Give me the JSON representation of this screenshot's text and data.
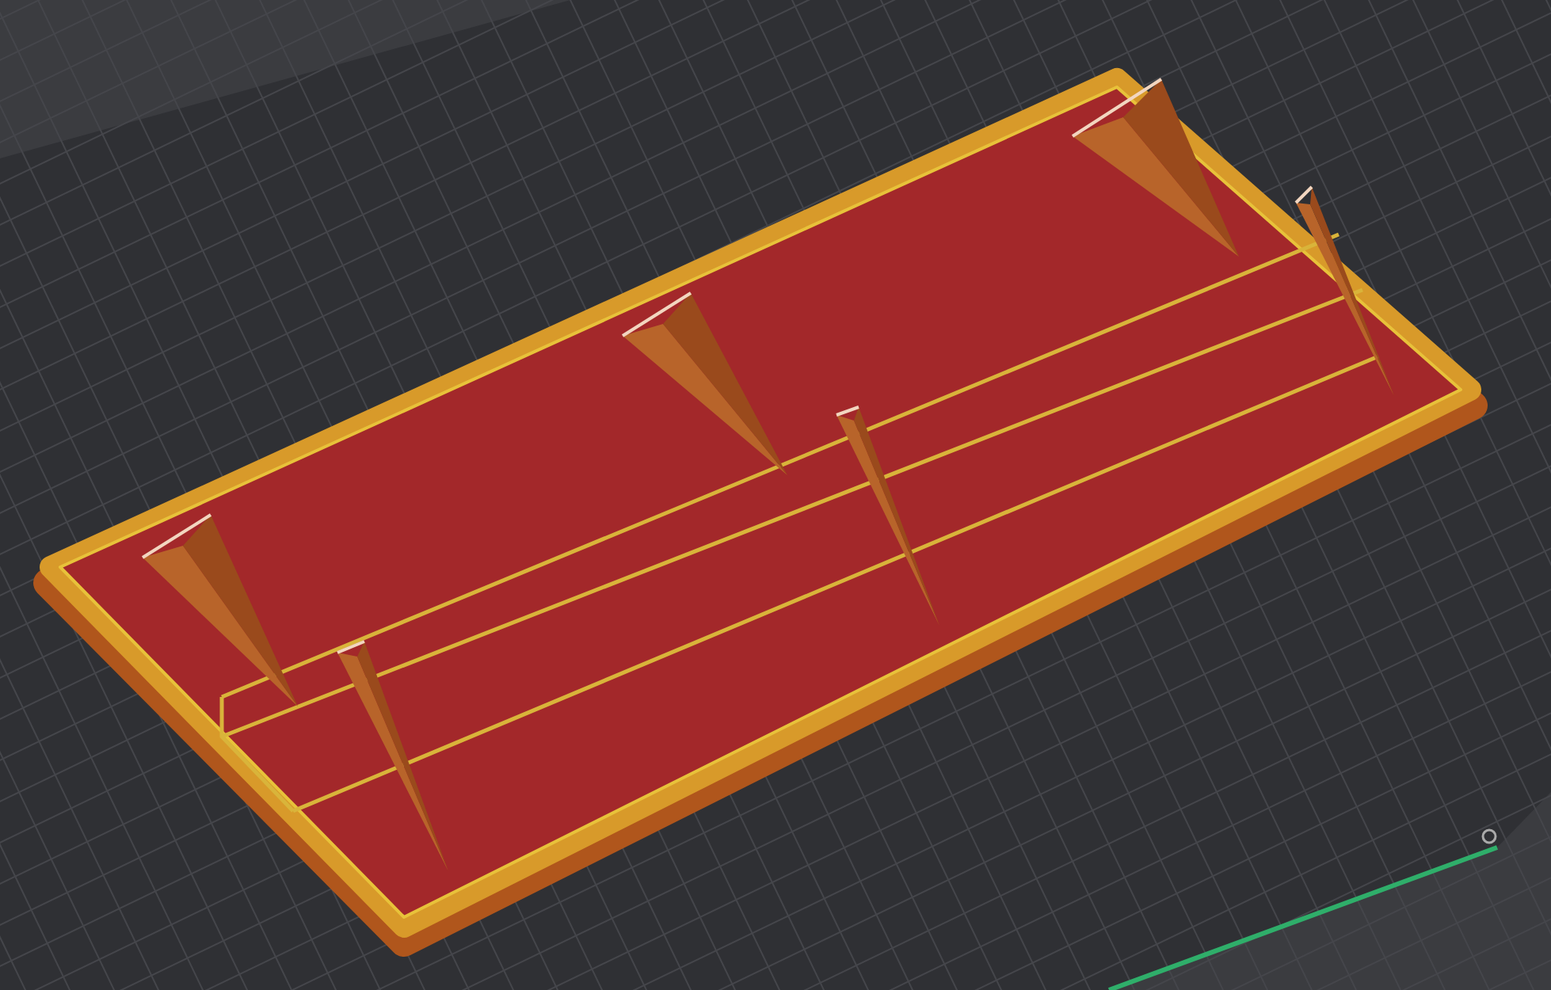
{
  "view": {
    "kind": "slicer-3d-preview"
  }
}
